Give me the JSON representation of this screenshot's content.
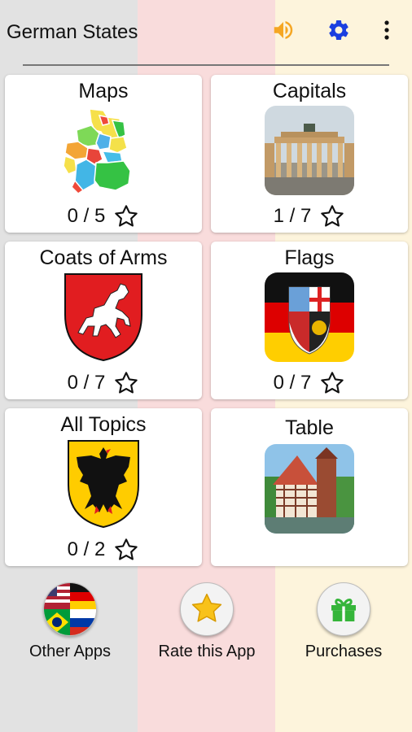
{
  "app_bar": {
    "title": "German States"
  },
  "cards": [
    {
      "title": "Maps",
      "score": "0 / 5"
    },
    {
      "title": "Capitals",
      "score": "1 / 7"
    },
    {
      "title": "Coats of Arms",
      "score": "0 / 7"
    },
    {
      "title": "Flags",
      "score": "0 / 7"
    },
    {
      "title": "All Topics",
      "score": "0 / 2"
    },
    {
      "title": "Table"
    }
  ],
  "bottom": [
    {
      "label": "Other Apps"
    },
    {
      "label": "Rate this App"
    },
    {
      "label": "Purchases"
    }
  ],
  "colors": {
    "accent_orange": "#f5a623",
    "settings_blue": "#1a3fe0",
    "gift_green": "#35b53a"
  },
  "icons": [
    "volume-icon",
    "gear-icon",
    "overflow-menu-icon",
    "star-outline-icon",
    "star-filled-icon",
    "gift-icon"
  ]
}
